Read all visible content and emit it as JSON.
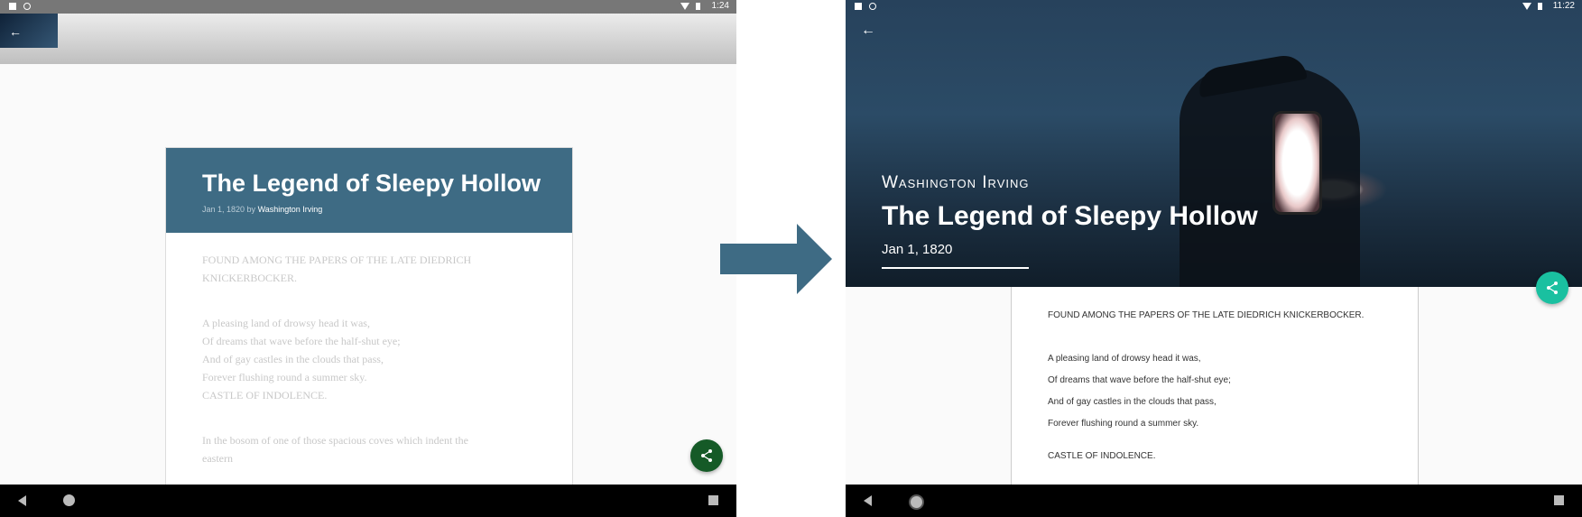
{
  "left": {
    "status_time": "1:24",
    "title": "The Legend of Sleepy Hollow",
    "meta_date_by": "Jan 1, 1820 by",
    "meta_author": "Washington Irving",
    "body": {
      "p1": "FOUND AMONG THE PAPERS OF THE LATE DIEDRICH KNICKERBOCKER.",
      "verse": [
        "A pleasing land of drowsy head it was,",
        "Of dreams that wave before the half-shut eye;",
        "And of gay castles in the clouds that pass,",
        "Forever flushing round a summer sky.",
        "CASTLE OF INDOLENCE."
      ],
      "p3": "In the bosom of one of those spacious coves which indent the eastern"
    },
    "fab_color": "#155a27",
    "header_color": "#3e6b84"
  },
  "right": {
    "status_time": "11:22",
    "author": "Washington Irving",
    "title": "The Legend of Sleepy Hollow",
    "date": "Jan 1, 1820",
    "body": {
      "p1": "FOUND AMONG THE PAPERS OF THE LATE DIEDRICH KNICKERBOCKER.",
      "verse": [
        "A pleasing land of drowsy head it was,",
        "Of dreams that wave before the half-shut eye;",
        "And of gay castles in the clouds that pass,",
        "Forever flushing round a summer sky."
      ],
      "closing": "CASTLE OF INDOLENCE."
    },
    "fab_color": "#1ac0a0"
  },
  "icons": [
    "back-arrow-icon",
    "share-icon",
    "wifi-icon",
    "battery-icon",
    "nav-back-icon",
    "nav-home-icon",
    "nav-recent-icon"
  ],
  "arrow_color": "#3e6b84"
}
